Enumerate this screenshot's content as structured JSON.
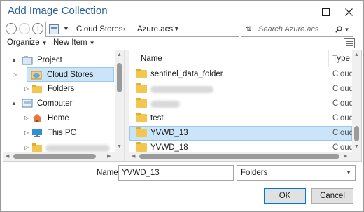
{
  "window": {
    "title": "Add Image Collection",
    "maximize_icon": "maximize-icon",
    "close_icon": "close-icon"
  },
  "address_bar": {
    "breadcrumbs": [
      "Cloud Stores",
      "Azure.acs"
    ],
    "search_placeholder": "Search Azure.acs"
  },
  "toolbar": {
    "organize_label": "Organize",
    "new_item_label": "New Item"
  },
  "tree": {
    "items": [
      {
        "label": "Project",
        "icon": "project-icon",
        "expander": "▲"
      },
      {
        "label": "Cloud Stores",
        "icon": "cloud-store-icon",
        "expander": "▷",
        "selected": true
      },
      {
        "label": "Folders",
        "icon": "folder-icon",
        "expander": "▷"
      },
      {
        "label": "Computer",
        "icon": "computer-icon",
        "expander": "▲"
      },
      {
        "label": "Home",
        "icon": "home-icon",
        "expander": "▷"
      },
      {
        "label": "This PC",
        "icon": "monitor-icon",
        "expander": "▷"
      },
      {
        "label": "",
        "icon": "folder-icon",
        "expander": "▷",
        "redacted": true
      }
    ]
  },
  "file_list": {
    "columns": {
      "name": "Name",
      "type": "Type"
    },
    "rows": [
      {
        "name": "sentinel_data_folder",
        "type": "Cloud S"
      },
      {
        "name": "",
        "type": "Cloud S",
        "redacted": true
      },
      {
        "name": "",
        "type": "Cloud S",
        "redacted": true
      },
      {
        "name": "test",
        "type": "Cloud S"
      },
      {
        "name": "YVWD_13",
        "type": "Cloud S",
        "selected": true
      },
      {
        "name": "YVWD_18",
        "type": "Cloud S"
      }
    ]
  },
  "footer": {
    "name_label": "Name",
    "name_value": "YVWD_13",
    "type_filter": "Folders",
    "ok_label": "OK",
    "cancel_label": "Cancel"
  },
  "colors": {
    "title": "#2a5f9e",
    "selection_bg": "#cce4f7",
    "selection_border": "#99c9ef",
    "folder": "#f3c74f",
    "button_default_border": "#0078d7"
  }
}
